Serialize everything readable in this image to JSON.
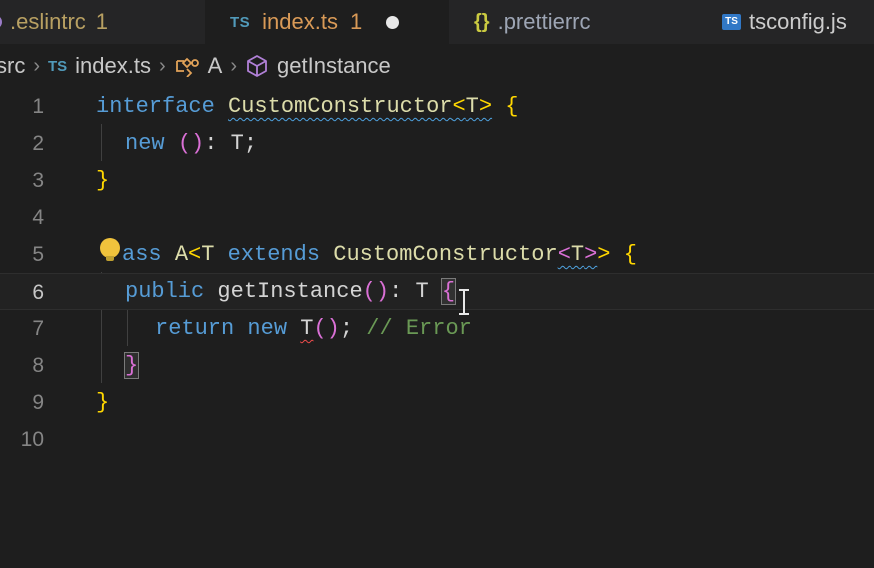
{
  "tabs": [
    {
      "label": ".eslintrc",
      "badge": "1",
      "icon": "eslint-icon"
    },
    {
      "label": "index.ts",
      "badge": "1",
      "icon": "ts-icon",
      "lang": "TS",
      "active": true,
      "dirty": true
    },
    {
      "label": ".prettierrc",
      "icon": "braces-icon",
      "glyph": "{}"
    },
    {
      "label": "tsconfig.js",
      "icon": "tsconfig-icon",
      "lang": "TS"
    }
  ],
  "breadcrumb": {
    "folder": "src",
    "file": "index.ts",
    "file_lang": "TS",
    "class_name": "A",
    "method": "getInstance"
  },
  "editor": {
    "line_numbers": [
      "1",
      "2",
      "3",
      "4",
      "5",
      "6",
      "7",
      "8",
      "9",
      "10"
    ],
    "current_line": 6,
    "code": {
      "l1_kw": "interface",
      "l1_name": "CustomConstructor",
      "l1_lt": "<",
      "l1_t": "T",
      "l1_gt": ">",
      "l1_open": "{",
      "l2_kw": "new",
      "l2_parens": "()",
      "l2_rest": ": T;",
      "l3_close": "}",
      "l5_kw_partial": "ass",
      "l5_name": "A",
      "l5_lt": "<",
      "l5_t": "T",
      "l5_extends": "extends",
      "l5_base": "CustomConstructor",
      "l5_lt2": "<",
      "l5_t2": "T",
      "l5_gt2": ">",
      "l5_gt": ">",
      "l5_open": "{",
      "l6_kw": "public",
      "l6_fn": "getInstance",
      "l6_parens": "()",
      "l6_colon": ": ",
      "l6_t": "T",
      "l6_open": "{",
      "l7_return": "return",
      "l7_new": "new",
      "l7_t": "T",
      "l7_parens": "()",
      "l7_semi": ";",
      "l7_comment": "// Error",
      "l8_close": "}",
      "l9_close": "}"
    }
  },
  "colors": {
    "background": "#1e1e1e",
    "keyword": "#569cd6",
    "type": "#dcdcaa",
    "bracket_gold": "#ffd700",
    "bracket_purple": "#da70d6",
    "comment": "#6a9955",
    "error_squiggle": "#f14c4c",
    "warning_squiggle": "#4fa3e0"
  }
}
